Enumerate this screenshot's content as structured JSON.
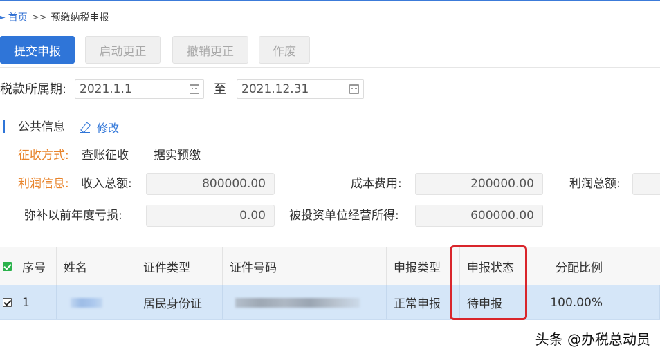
{
  "breadcrumb": {
    "home": "首页",
    "separator": ">>",
    "current": "预缴纳税申报"
  },
  "toolbar": {
    "submit_label": "提交申报",
    "start_correction_label": "启动更正",
    "cancel_correction_label": "撤销更正",
    "void_label": "作废"
  },
  "period": {
    "label": "税款所属期:",
    "start": "2021.1.1",
    "to": "至",
    "end": "2021.12.31"
  },
  "public_info": {
    "title": "公共信息",
    "edit_label": "修改",
    "collection_method_label": "征收方式:",
    "collection_method_value": "查账征收",
    "prepay_method_value": "据实预缴",
    "profit_info_label": "利润信息:",
    "total_income_label": "收入总额:",
    "total_income_value": "800000.00",
    "cost_label": "成本费用:",
    "cost_value": "200000.00",
    "total_profit_label": "利润总额:",
    "total_profit_value": "",
    "prior_loss_label": "弥补以前年度亏损:",
    "prior_loss_value": "0.00",
    "investee_income_label": "被投资单位经营所得:",
    "investee_income_value": "600000.00"
  },
  "table": {
    "headers": [
      "序号",
      "姓名",
      "证件类型",
      "证件号码",
      "申报类型",
      "申报状态",
      "分配比例"
    ],
    "rows": [
      {
        "index": "1",
        "name": "",
        "id_type": "居民身份证",
        "id_number": "",
        "filing_type": "正常申报",
        "status": "待申报",
        "ratio": "100.00%"
      }
    ]
  },
  "watermark": "头条 @办税总动员",
  "colors": {
    "primary": "#2f75d8",
    "orange_label": "#e8842c",
    "highlight": "#d9252b",
    "selected_row": "#d5e6f8"
  }
}
